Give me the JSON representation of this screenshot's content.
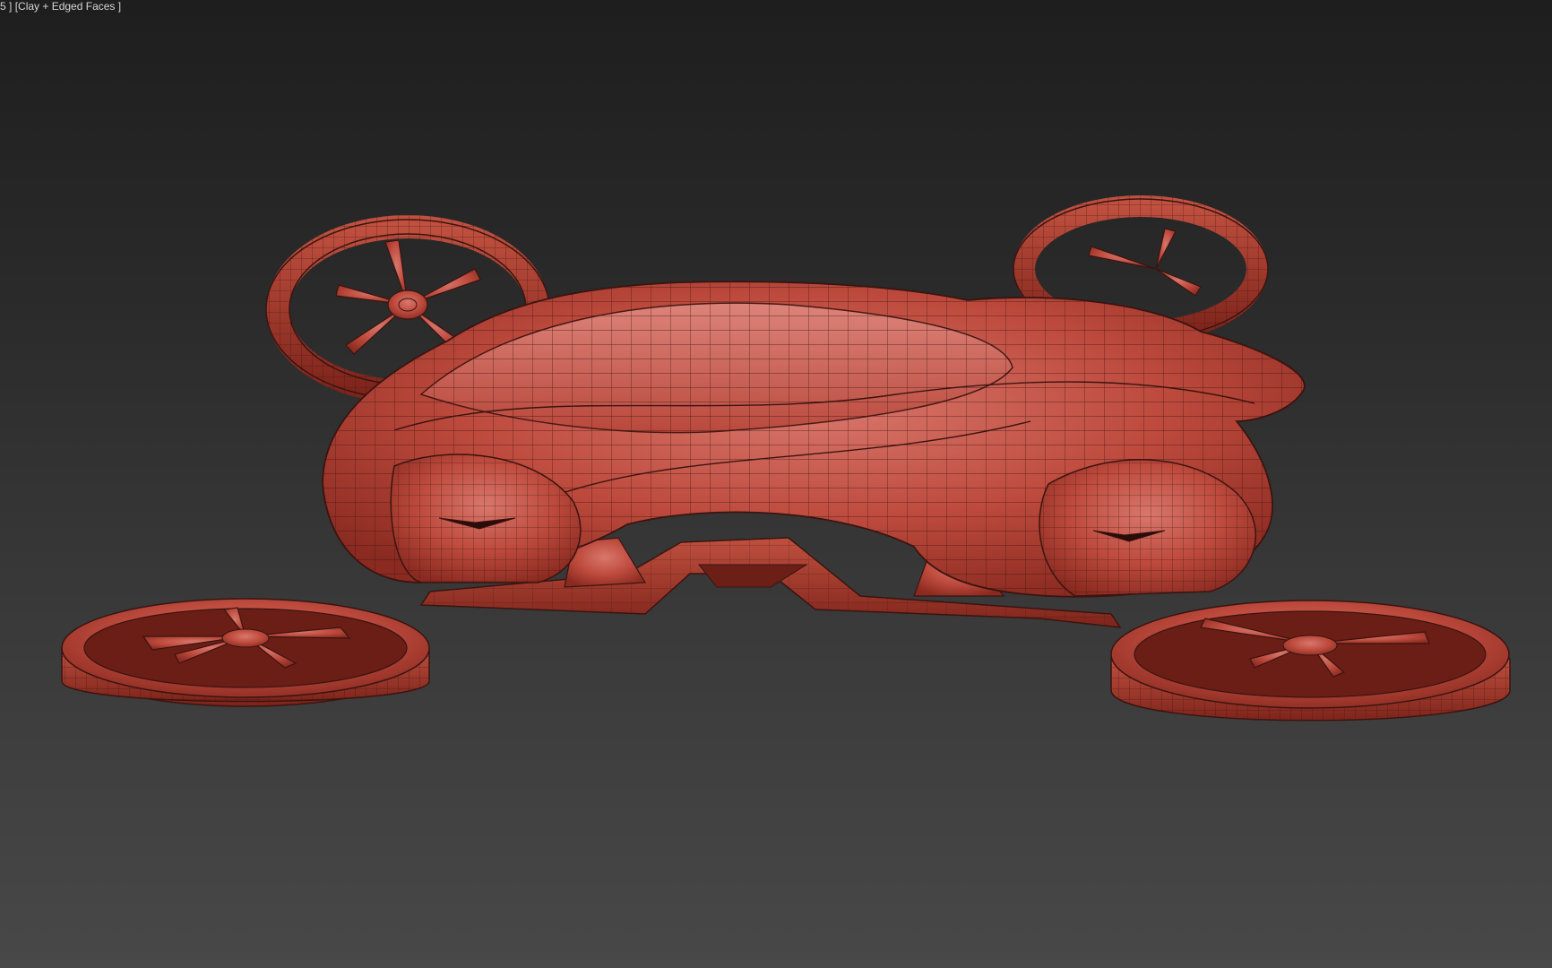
{
  "viewport": {
    "label_view": "5 ]",
    "label_mode": "[Clay + Edged Faces ]",
    "shading": "Clay + Edged Faces"
  },
  "model": {
    "name": "",
    "clay_color": "#b9483c",
    "wire_color": "#3a1410"
  },
  "colors": {
    "background_top": "#1e1e1e",
    "background_bottom": "#484848",
    "label_text": "#d6d6d6"
  }
}
